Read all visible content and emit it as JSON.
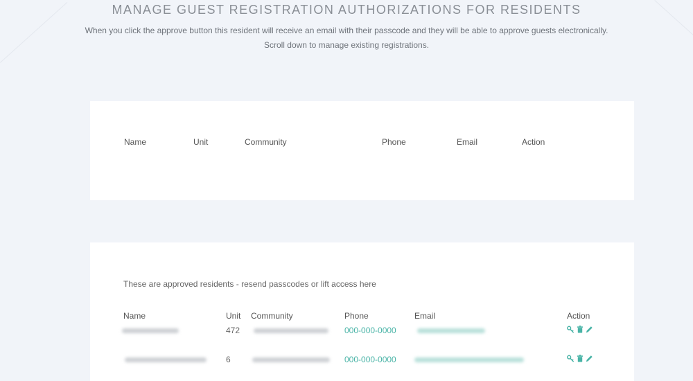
{
  "header": {
    "title": "MANAGE GUEST REGISTRATION AUTHORIZATIONS FOR RESIDENTS",
    "subtitle_line1": "When you click the approve button this resident will receive an email with their passcode and they will be able to approve guests electronically.",
    "subtitle_line2": "Scroll down to manage existing registrations."
  },
  "pending_table": {
    "columns": [
      "Name",
      "Unit",
      "Community",
      "Phone",
      "Email",
      "Action"
    ]
  },
  "approved_section": {
    "note": "These are approved residents - resend passcodes or lift access here",
    "columns": [
      "Name",
      "Unit",
      "Community",
      "Phone",
      "Email",
      "Action"
    ],
    "rows": [
      {
        "unit": "472",
        "phone": "000-000-0000"
      },
      {
        "unit": "6",
        "phone": "000-000-0000"
      }
    ]
  },
  "icons": {
    "resend": "key-icon",
    "delete": "trash-icon",
    "edit": "pencil-icon"
  },
  "colors": {
    "background": "#f1f4f9",
    "accent": "#48b3a6",
    "card": "#ffffff"
  }
}
